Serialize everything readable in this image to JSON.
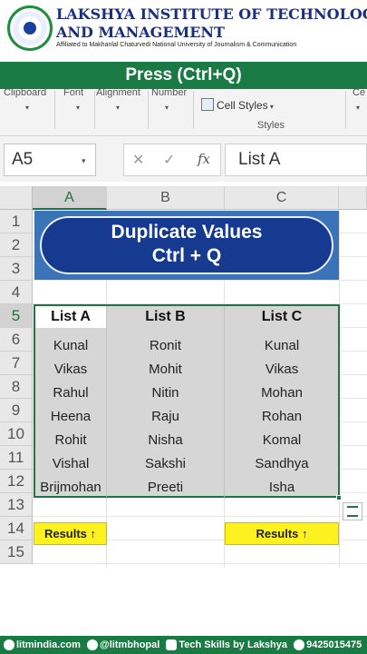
{
  "header": {
    "line1": "LAKSHYA INSTITUTE OF TECHNOLOGY",
    "line2": "AND MANAGEMENT",
    "affiliation": "Affiliated to Makhanlal Chaturvedi National University of Journalism & Communication",
    "logo_icon": "institute-logo-icon"
  },
  "banner": "Press (Ctrl+Q)",
  "ribbon": {
    "groups": [
      "Clipboard",
      "Font",
      "Alignment",
      "Number",
      "Ce"
    ],
    "cell_styles": "Cell Styles",
    "styles_group": "Styles"
  },
  "formula_bar": {
    "name_box": "A5",
    "fx": "fx",
    "content": "List A"
  },
  "sheet": {
    "columns": [
      "A",
      "B",
      "C"
    ],
    "rows": [
      "1",
      "2",
      "3",
      "4",
      "5",
      "6",
      "7",
      "8",
      "9",
      "10",
      "11",
      "12",
      "13",
      "14",
      "15"
    ],
    "title_line1": "Duplicate Values",
    "title_line2": "Ctrl + Q",
    "headers": [
      "List A",
      "List B",
      "List C"
    ],
    "data": [
      [
        "Kunal",
        "Ronit",
        "Kunal"
      ],
      [
        "Vikas",
        "Mohit",
        "Vikas"
      ],
      [
        "Rahul",
        "Nitin",
        "Mohan"
      ],
      [
        "Heena",
        "Raju",
        "Rohan"
      ],
      [
        "Rohit",
        "Nisha",
        "Komal"
      ],
      [
        "Vishal",
        "Sakshi",
        "Sandhya"
      ],
      [
        "Brijmohan",
        "Preeti",
        "Isha"
      ]
    ],
    "result_a": "Results ↑",
    "result_c": "Results ↑",
    "accent_color": "#217346",
    "title_color": "#163a8f",
    "result_color": "#fdf21f"
  },
  "footer": {
    "website": "litmindia.com",
    "instagram": "@litmbhopal",
    "youtube": "Tech Skills by Lakshya",
    "phone": "9425015475",
    "color": "#1a7a44"
  }
}
